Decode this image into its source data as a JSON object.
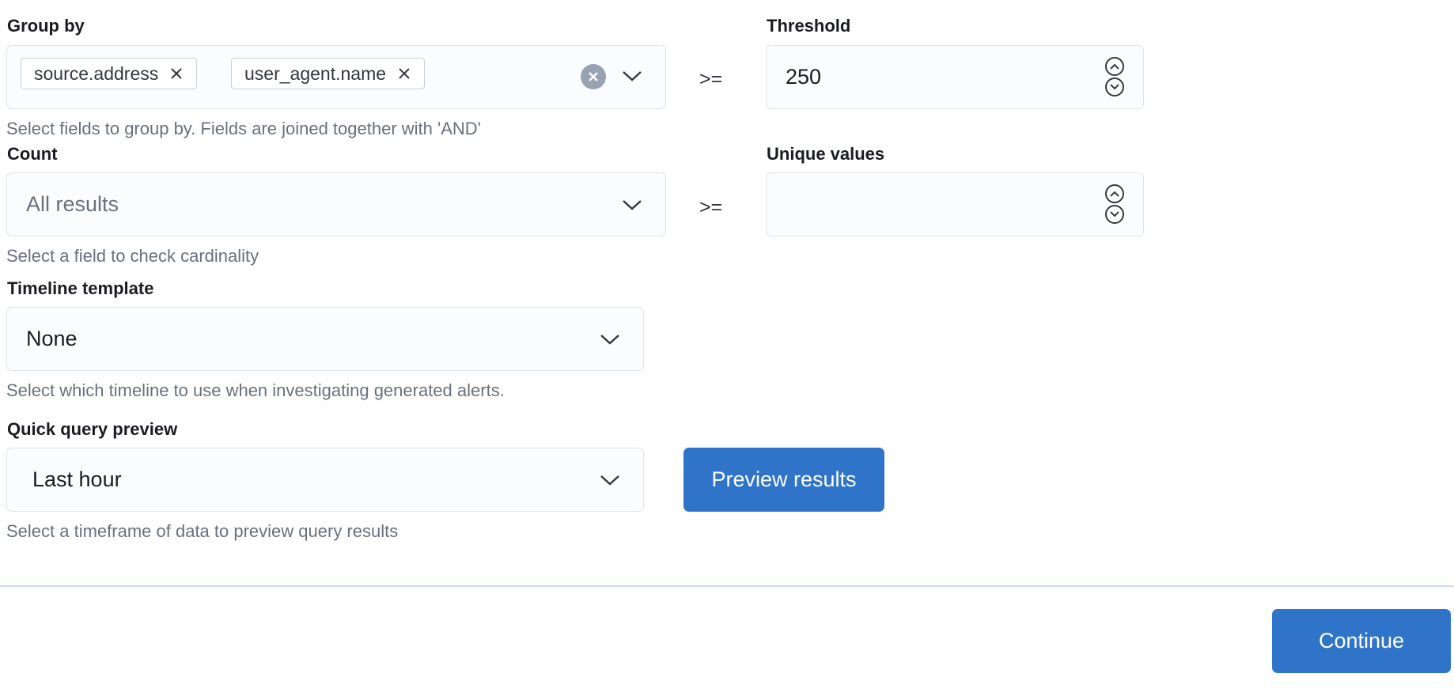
{
  "group_by": {
    "label": "Group by",
    "chips": [
      "source.address",
      "user_agent.name"
    ],
    "help": "Select fields to group by. Fields are joined together with 'AND'"
  },
  "threshold": {
    "label": "Threshold",
    "operator": ">=",
    "value": "250"
  },
  "count": {
    "label": "Count",
    "placeholder": "All results",
    "help": "Select a field to check cardinality"
  },
  "unique_values": {
    "label": "Unique values",
    "operator": ">=",
    "value": ""
  },
  "timeline_template": {
    "label": "Timeline template",
    "value": "None",
    "help": "Select which timeline to use when investigating generated alerts."
  },
  "quick_query_preview": {
    "label": "Quick query preview",
    "value": "Last hour",
    "help": "Select a timeframe of data to preview query results",
    "button": "Preview results"
  },
  "footer": {
    "continue": "Continue"
  },
  "icons": {
    "clear": "clear-icon",
    "chevron": "chevron-down-icon",
    "chip_remove": "close-icon",
    "step_up": "chevron-up-icon",
    "step_down": "chevron-down-icon"
  },
  "colors": {
    "primary": "#2f74c8",
    "help_text": "#69707d",
    "border": "#dfe3ea"
  }
}
